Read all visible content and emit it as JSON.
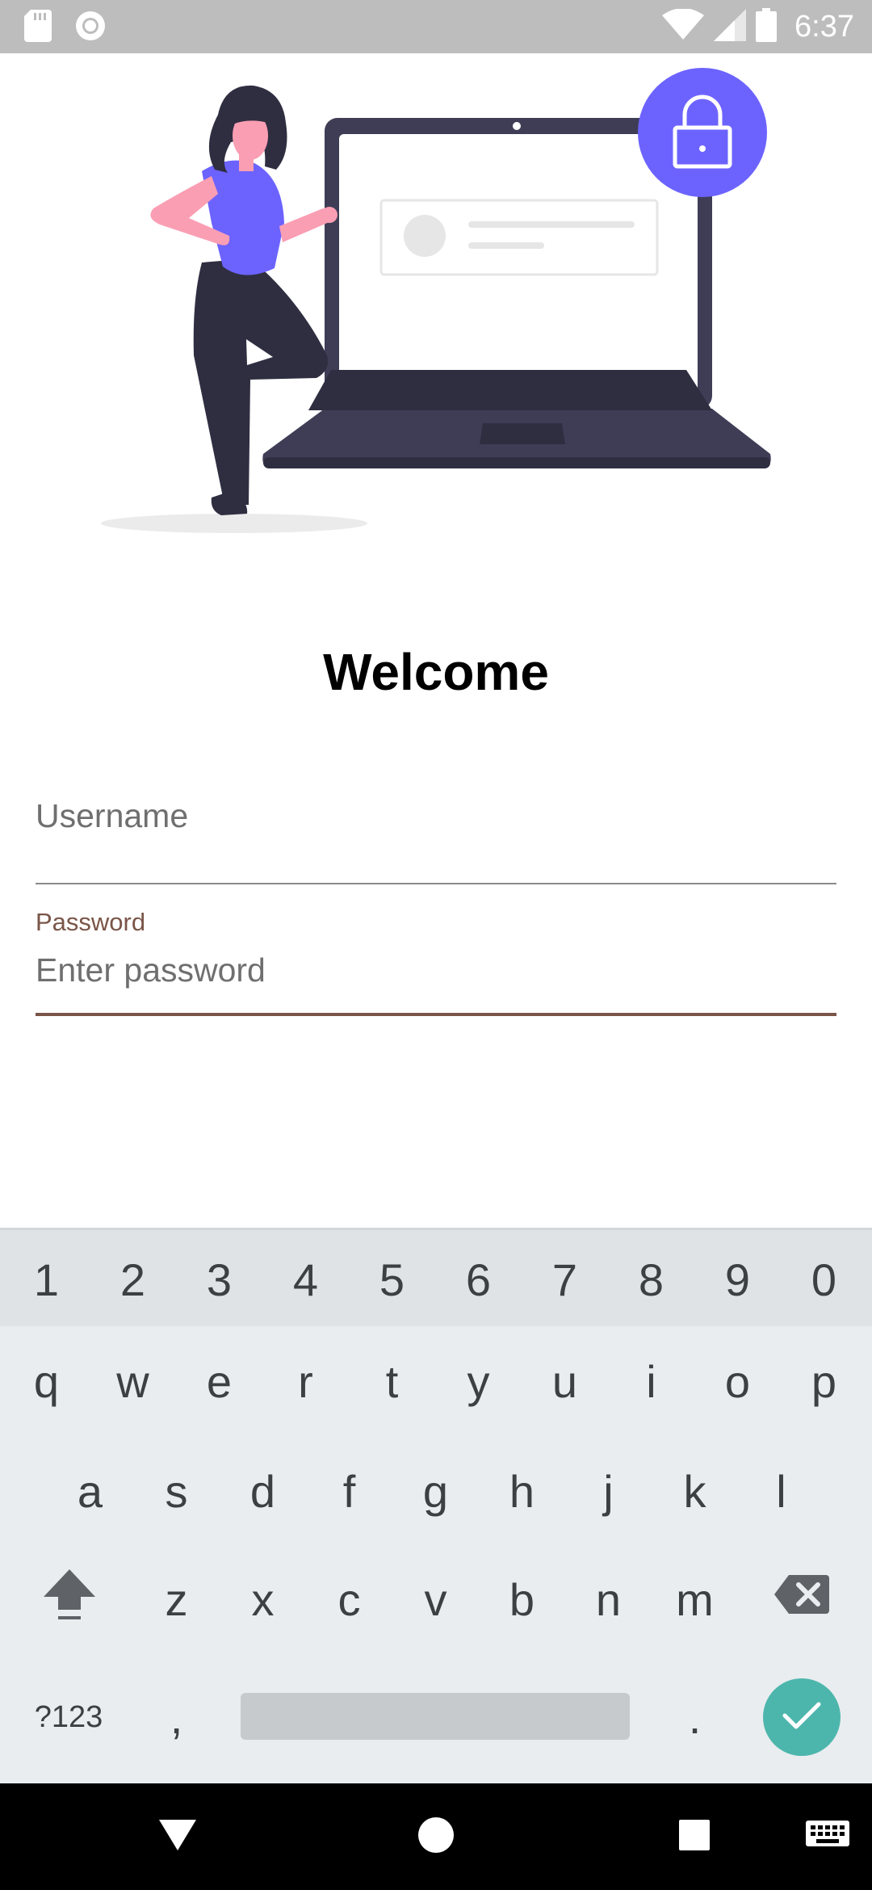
{
  "status_bar": {
    "time": "6:37",
    "icons": [
      "sd-card-icon",
      "circle-notification-icon",
      "wifi-icon",
      "signal-icon",
      "battery-icon"
    ]
  },
  "colors": {
    "accent": "#6c63ff",
    "field_focus": "#7a5548",
    "enter_key": "#4db6ac",
    "keyboard_bg": "#e9edf0",
    "status_bar_bg": "#bdbdbd"
  },
  "illustration": {
    "name": "login-illustration",
    "lock_icon": "lock-icon"
  },
  "title": "Welcome",
  "form": {
    "username": {
      "placeholder": "Username",
      "value": ""
    },
    "password": {
      "label": "Password",
      "placeholder": "Enter password",
      "value": ""
    }
  },
  "keyboard": {
    "number_row": [
      "1",
      "2",
      "3",
      "4",
      "5",
      "6",
      "7",
      "8",
      "9",
      "0"
    ],
    "row1": [
      "q",
      "w",
      "e",
      "r",
      "t",
      "y",
      "u",
      "i",
      "o",
      "p"
    ],
    "row2": [
      "a",
      "s",
      "d",
      "f",
      "g",
      "h",
      "j",
      "k",
      "l"
    ],
    "row3": [
      "z",
      "x",
      "c",
      "v",
      "b",
      "n",
      "m"
    ],
    "symbols_key": "?123",
    "comma_key": ",",
    "period_key": ".",
    "shift_icon": "shift-icon",
    "backspace_icon": "backspace-icon",
    "enter_icon": "check-icon"
  },
  "nav_bar": {
    "icons": [
      "back-icon",
      "home-icon",
      "recents-icon",
      "keyboard-switch-icon"
    ]
  }
}
